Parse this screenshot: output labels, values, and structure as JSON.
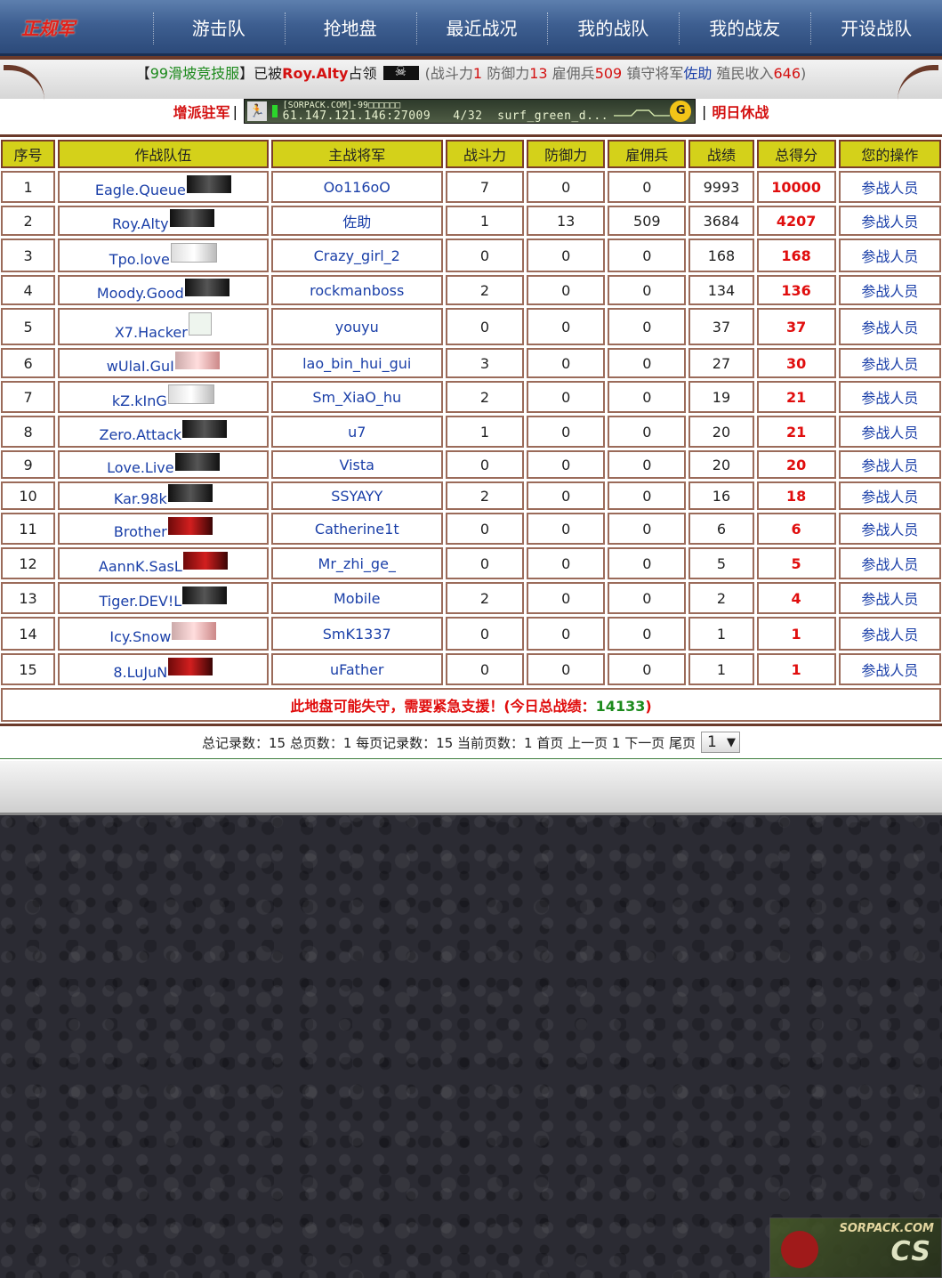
{
  "nav": {
    "items": [
      {
        "label": "正规军",
        "active": true
      },
      {
        "label": "游击队"
      },
      {
        "label": "抢地盘"
      },
      {
        "label": "最近战况"
      },
      {
        "label": "我的战队"
      },
      {
        "label": "我的战友"
      },
      {
        "label": "开设战队"
      }
    ]
  },
  "occupy": {
    "open_bracket": "【",
    "server": "99滑坡竞技服",
    "close_bracket": "】",
    "taken_by": "已被",
    "team": "Roy.Alty",
    "occupied": "占领",
    "open_paren": "(",
    "atk_label": "战斗力",
    "atk": "1",
    "def_label": "防御力",
    "def": "13",
    "merc_label": "雇佣兵",
    "merc": "509",
    "guard_label": "镇守将军",
    "guard": "佐助",
    "income_label": "殖民收入",
    "income": "646",
    "close_paren": ")"
  },
  "server_row": {
    "reinforce": "增派驻军",
    "separator": "|",
    "banner_top": "[SORPACK.COM]-99□□□□□□",
    "banner_ip": "61.147.121.146:27009",
    "banner_players": "4/32",
    "banner_map": "surf_green_d...",
    "rest": "明日休战"
  },
  "table": {
    "headers": [
      "序号",
      "作战队伍",
      "主战将军",
      "战斗力",
      "防御力",
      "雇佣兵",
      "战绩",
      "总得分",
      "您的操作"
    ],
    "rows": [
      {
        "no": "1",
        "team": "Eagle.Queue",
        "general": "Oo116oO",
        "atk": "7",
        "def": "0",
        "merc": "0",
        "record": "9993",
        "score": "10000",
        "action": "参战人员"
      },
      {
        "no": "2",
        "team": "Roy.Alty",
        "general": "佐助",
        "atk": "1",
        "def": "13",
        "merc": "509",
        "record": "3684",
        "score": "4207",
        "action": "参战人员"
      },
      {
        "no": "3",
        "team": "Tpo.love",
        "general": "Crazy_girl_2",
        "atk": "0",
        "def": "0",
        "merc": "0",
        "record": "168",
        "score": "168",
        "action": "参战人员"
      },
      {
        "no": "4",
        "team": "Moody.Good",
        "general": "rockmanboss",
        "atk": "2",
        "def": "0",
        "merc": "0",
        "record": "134",
        "score": "136",
        "action": "参战人员"
      },
      {
        "no": "5",
        "team": "X7.Hacker",
        "general": "youyu",
        "atk": "0",
        "def": "0",
        "merc": "0",
        "record": "37",
        "score": "37",
        "action": "参战人员"
      },
      {
        "no": "6",
        "team": "wUlaI.GuI",
        "general": "lao_bin_hui_gui",
        "atk": "3",
        "def": "0",
        "merc": "0",
        "record": "27",
        "score": "30",
        "action": "参战人员"
      },
      {
        "no": "7",
        "team": "kZ.kInG",
        "general": "Sm_XiaO_hu",
        "atk": "2",
        "def": "0",
        "merc": "0",
        "record": "19",
        "score": "21",
        "action": "参战人员"
      },
      {
        "no": "8",
        "team": "Zero.Attack",
        "general": "u7",
        "atk": "1",
        "def": "0",
        "merc": "0",
        "record": "20",
        "score": "21",
        "action": "参战人员"
      },
      {
        "no": "9",
        "team": "Love.Live",
        "general": "Vista",
        "atk": "0",
        "def": "0",
        "merc": "0",
        "record": "20",
        "score": "20",
        "action": "参战人员"
      },
      {
        "no": "10",
        "team": "Kar.98k",
        "general": "SSYAYY",
        "atk": "2",
        "def": "0",
        "merc": "0",
        "record": "16",
        "score": "18",
        "action": "参战人员"
      },
      {
        "no": "11",
        "team": "Brother",
        "general": "Catherine1t",
        "atk": "0",
        "def": "0",
        "merc": "0",
        "record": "6",
        "score": "6",
        "action": "参战人员"
      },
      {
        "no": "12",
        "team": "AannK.SasL",
        "general": "Mr_zhi_ge_",
        "atk": "0",
        "def": "0",
        "merc": "0",
        "record": "5",
        "score": "5",
        "action": "参战人员"
      },
      {
        "no": "13",
        "team": "Tiger.DEV!L",
        "general": "Mobile",
        "atk": "2",
        "def": "0",
        "merc": "0",
        "record": "2",
        "score": "4",
        "action": "参战人员"
      },
      {
        "no": "14",
        "team": "Icy.Snow",
        "general": "SmK1337",
        "atk": "0",
        "def": "0",
        "merc": "0",
        "record": "1",
        "score": "1",
        "action": "参战人员"
      },
      {
        "no": "15",
        "team": "8.LuJuN",
        "general": "uFather",
        "atk": "0",
        "def": "0",
        "merc": "0",
        "record": "1",
        "score": "1",
        "action": "参战人员"
      }
    ],
    "footer_msg": "此地盘可能失守，需要紧急支援！(今日总战绩：",
    "footer_total": "14133",
    "footer_end": ")"
  },
  "pager": {
    "text": "总记录数：15 总页数：1 每页记录数：15 当前页数：1 首页 上一页 1 下一页 尾页",
    "selected_page": "1"
  },
  "watermark": {
    "top": "SORPACK.COM",
    "big": "CS"
  },
  "colors": {
    "nav_bg": "#3e5f91",
    "header_bg": "#d4d11a",
    "border_brown": "#6b3a2a",
    "score_red": "#e00d0d",
    "link_blue": "#1a3fa8"
  }
}
